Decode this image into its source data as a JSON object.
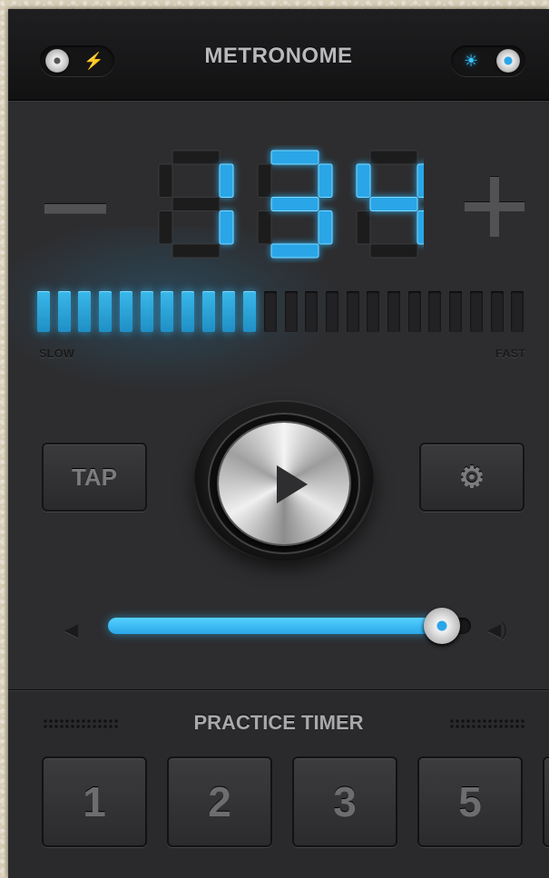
{
  "header": {
    "title": "METRONOME",
    "left_toggle_glyph": "⚡",
    "right_toggle_glyph": "☀"
  },
  "tempo": {
    "bpm": "134",
    "minus_label": "−",
    "plus_label": "+",
    "level_fraction": 0.44,
    "segments_total": 24,
    "segments_lit": 11,
    "slow_label": "SLOW",
    "fast_label": "FAST"
  },
  "controls": {
    "tap_label": "TAP",
    "settings_icon": "⚙",
    "play_icon": "play-icon"
  },
  "volume": {
    "level_fraction": 0.92,
    "low_icon": "◀",
    "high_icon": "◀)"
  },
  "practice_timer": {
    "title": "PRACTICE TIMER",
    "options": [
      "1",
      "2",
      "3",
      "5"
    ]
  },
  "colors": {
    "accent": "#2aa6e8",
    "panel": "#2d2d2f"
  }
}
